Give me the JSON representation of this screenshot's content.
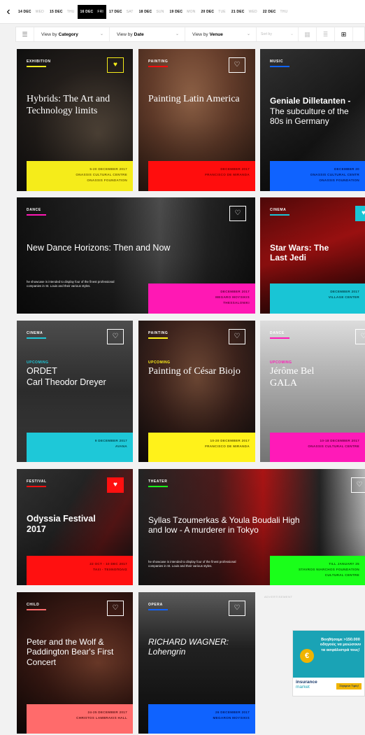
{
  "date_bar": {
    "days": [
      {
        "date": "14 DEC",
        "weekday": "WED",
        "active": false
      },
      {
        "date": "15 DEC",
        "weekday": "THU",
        "active": false
      },
      {
        "date": "16 DEC",
        "weekday": "FRI",
        "active": true
      },
      {
        "date": "17 DEC",
        "weekday": "SAT",
        "active": false
      },
      {
        "date": "18 DEC",
        "weekday": "SUN",
        "active": false
      },
      {
        "date": "19 DEC",
        "weekday": "MON",
        "active": false
      },
      {
        "date": "20 DEC",
        "weekday": "TUE",
        "active": false
      },
      {
        "date": "21 DEC",
        "weekday": "WED",
        "active": false
      },
      {
        "date": "22 DEC",
        "weekday": "THU",
        "active": false
      }
    ]
  },
  "filters": {
    "category_prefix": "View by",
    "category_value": "Category",
    "date_prefix": "View by",
    "date_value": "Date",
    "venue_prefix": "View by",
    "venue_value": "Venue",
    "sort_placeholder": "Sort by"
  },
  "events": [
    {
      "id": "hybrids",
      "category": "EXHIBITION",
      "title": "Hybrids: The Art and Technology limits",
      "info": [
        "5-20 DECEMBER 2017",
        "ONASSIS CULTURAL CENTRE",
        "ONASSIS FOUNDATION"
      ],
      "favorited": true,
      "accent": "#f5ec1a"
    },
    {
      "id": "painting-latin",
      "category": "PAINTING",
      "title": "Painting Latin America",
      "info": [
        "DECEMBER 2017",
        "FRANCISCO DE MIRANDA"
      ],
      "favorited": false,
      "accent": "#ff0d0d"
    },
    {
      "id": "geniale",
      "category": "MUSIC",
      "title": "Geniale Dilletanten -",
      "subtitle": "The subculture of the 80s in Germany",
      "info": [
        "DECEMBER 20",
        "ONASSIS CULTURAL CENTR",
        "ONASSIS FOUNDATION"
      ],
      "favorited": false,
      "accent": "#0f63ff"
    },
    {
      "id": "dance-horizons",
      "category": "DANCE",
      "title": "New Dance Horizons: Then and Now",
      "description": "he showcase is intended to display four of the finest professional companies in St. Louis and their various styles.",
      "info": [
        "DECEMBER 2017",
        "MEGARO MOYSIKIS",
        "THESSALONIKI"
      ],
      "favorited": false,
      "accent": "#ff18b4"
    },
    {
      "id": "star-wars",
      "category": "CINEMA",
      "title": "Star Wars: The Last Jedi",
      "info": [
        "DECEMBER 2017",
        "VILLAGE CENTER"
      ],
      "favorited": true,
      "accent": "#19c5d5"
    },
    {
      "id": "ordet",
      "category": "CINEMA",
      "upcoming": "UPCOMING",
      "title": "ORDET",
      "subtitle": "Carl Theodor Dreyer",
      "info": [
        "9 DECEMBER 2017",
        "AVANA"
      ],
      "favorited": false,
      "accent": "#1ec8d8"
    },
    {
      "id": "cesar-biojo",
      "category": "PAINTING",
      "upcoming": "UPCOMING",
      "title": "Painting of César Biojo",
      "info": [
        "10-20 DECEMBER 2017",
        "FRANCISCO DE MIRANDA"
      ],
      "favorited": false,
      "accent": "#fff21a"
    },
    {
      "id": "jerome-bel",
      "category": "DANCE",
      "upcoming": "UPCOMING",
      "title": "Jérôme Bel GALA",
      "info": [
        "10-18 DECEMBER 2017",
        "ONASSIS CULTURAL CENTRE"
      ],
      "favorited": false,
      "accent": "#ff1ab8"
    },
    {
      "id": "odyssia",
      "category": "FESTIVAL",
      "title": "Odyssia Festival 2017",
      "info": [
        "22 OCT - 10 DEC 2017",
        "ΤΑΞΙ - ΤΕΧΝΟΠΟΛΙΣ"
      ],
      "favorited": true,
      "accent": "#ff1010"
    },
    {
      "id": "syllas",
      "category": "THEATER",
      "title": "Syllas Tzoumerkas & Youla Boudali High and low - A murderer in Tokyo",
      "description": "he showcase is intended to display four of the finest professional companies in St. Louis and their various styles.",
      "info": [
        "TILL JANUARY 25",
        "STAVROS NIARCHOS FOUNDATION",
        "CULTURAL CENTRE"
      ],
      "favorited": false,
      "accent": "#1aff1a"
    },
    {
      "id": "peter-wolf",
      "category": "CHILD",
      "title": "Peter and the Wolf & Paddington Bear's First Concert",
      "info": [
        "24-25 DECEMBER 2017",
        "CHRISTOS LAMBRAKIS HALL"
      ],
      "favorited": false,
      "accent": "#ff6b6b"
    },
    {
      "id": "wagner",
      "category": "OPERA",
      "title": "RICHARD WAGNER: Lohengrin",
      "info": [
        "26 DECEMBER 2017",
        "MEGARON MOYSIKIS"
      ],
      "favorited": false,
      "accent": "#0f63ff"
    }
  ],
  "ad": {
    "label": "ADVERTISEMENT",
    "headline": "Βοηθήσαμε >150.000 οδηγούς να μειώσουν τα ασφάλιστρά τους!",
    "coin": "€",
    "brand_line1": "insurance",
    "brand_line2": "market",
    "cta": "Σύγκρινε Τιμές!"
  },
  "colors": {
    "exhibition": "#f5ec1a",
    "painting": "#ff0d0d",
    "music": "#0f63ff",
    "dance": "#ff18b4",
    "cinema": "#19c5d5",
    "festival": "#ff1010",
    "theater": "#1aff1a",
    "child": "#ff6b6b",
    "opera": "#0f63ff"
  }
}
